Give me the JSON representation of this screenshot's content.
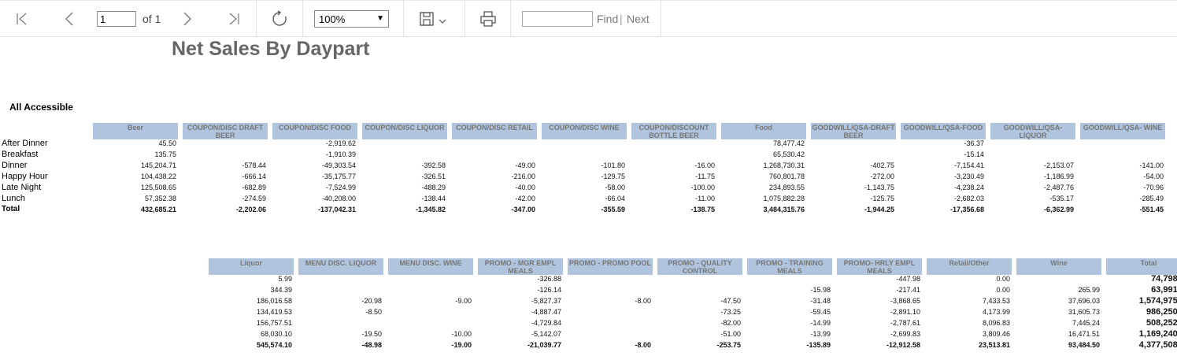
{
  "toolbar": {
    "page_value": "1",
    "of_label": "of 1",
    "zoom_value": "100%",
    "find_label": "Find",
    "find_separator": "|",
    "next_label": "Next"
  },
  "report": {
    "title": "Net Sales By Daypart",
    "subtitle": "All Accessible",
    "rows": [
      "After Dinner",
      "Breakfast",
      "Dinner",
      "Happy Hour",
      "Late Night",
      "Lunch",
      "Total"
    ],
    "table1": {
      "columns": [
        "Beer",
        "COUPON/DISC DRAFT BEER",
        "COUPON/DISC FOOD",
        "COUPON/DISC LIQUOR",
        "COUPON/DISC RETAIL",
        "COUPON/DISC WINE",
        "COUPON/DISCOUNT BOTTLE BEER",
        "Food",
        "GOODWILL/QSA-DRAFT BEER",
        "GOODWILL/QSA-FOOD",
        "GOODWILL/QSA-LIQUOR",
        "GOODWILL/QSA- WINE"
      ],
      "data": [
        [
          "45.50",
          "",
          "-2,919.62",
          "",
          "",
          "",
          "",
          "78,477.42",
          "",
          "-36.37",
          "",
          ""
        ],
        [
          "135.75",
          "",
          "-1,910.39",
          "",
          "",
          "",
          "",
          "65,530.42",
          "",
          "-15.14",
          "",
          ""
        ],
        [
          "145,204.71",
          "-578.44",
          "-49,303.54",
          "-392.58",
          "-49.00",
          "-101.80",
          "-16.00",
          "1,268,730.31",
          "-402.75",
          "-7,154.41",
          "-2,153.07",
          "-141.00"
        ],
        [
          "104,438.22",
          "-666.14",
          "-35,175.77",
          "-326.51",
          "-216.00",
          "-129.75",
          "-11.75",
          "760,801.78",
          "-272.00",
          "-3,230.49",
          "-1,186.99",
          "-54.00"
        ],
        [
          "125,508.65",
          "-682.89",
          "-7,524.99",
          "-488.29",
          "-40.00",
          "-58.00",
          "-100.00",
          "234,893.55",
          "-1,143.75",
          "-4,238.24",
          "-2,487.76",
          "-70.96"
        ],
        [
          "57,352.38",
          "-274.59",
          "-40,208.00",
          "-138.44",
          "-42.00",
          "-66.04",
          "-11.00",
          "1,075,882.28",
          "-125.75",
          "-2,682.03",
          "-535.17",
          "-285.49"
        ],
        [
          "432,685.21",
          "-2,202.06",
          "-137,042.31",
          "-1,345.82",
          "-347.00",
          "-355.59",
          "-138.75",
          "3,484,315.76",
          "-1,944.25",
          "-17,356.68",
          "-6,362.99",
          "-551.45"
        ]
      ]
    },
    "table2": {
      "columns": [
        "Liquor",
        "MENU DISC. LIQUOR",
        "MENU DISC. WINE",
        "PROMO - MGR EMPL MEALS",
        "PROMO - PROMO POOL",
        "PROMO - QUALITY CONTROL",
        "PROMO - TRAINING MEALS",
        "PROMO- HRLY EMPL MEALS",
        "Retail/Other",
        "Wine",
        "Total"
      ],
      "data": [
        [
          "5.99",
          "",
          "",
          "-326.88",
          "",
          "",
          "",
          "-447.98",
          "0.00",
          "",
          "74,798.06"
        ],
        [
          "344.39",
          "",
          "",
          "-126.14",
          "",
          "",
          "-15.98",
          "-217.41",
          "0.00",
          "265.99",
          "63,991.49"
        ],
        [
          "186,016.58",
          "-20.98",
          "-9.00",
          "-5,827.37",
          "-8.00",
          "-47.50",
          "-31.48",
          "-3,868.65",
          "7,433.53",
          "37,696.03",
          "1,574,975.59"
        ],
        [
          "134,419.53",
          "-8.50",
          "",
          "-4,887.47",
          "",
          "-73.25",
          "-59.45",
          "-2,891.10",
          "4,173.99",
          "31,605.73",
          "986,250.08"
        ],
        [
          "156,757.51",
          "",
          "",
          "-4,729.84",
          "",
          "-82.00",
          "-14.99",
          "-2,787.61",
          "8,096.83",
          "7,445.24",
          "508,252.46"
        ],
        [
          "68,030.10",
          "-19.50",
          "-10.00",
          "-5,142.07",
          "",
          "-51.00",
          "-13.99",
          "-2,699.83",
          "3,809.46",
          "16,471.51",
          "1,169,240.83"
        ],
        [
          "545,574.10",
          "-48.98",
          "-19.00",
          "-21,039.77",
          "-8.00",
          "-253.75",
          "-135.89",
          "-12,912.58",
          "23,513.81",
          "93,484.50",
          "4,377,508.51"
        ]
      ]
    }
  }
}
